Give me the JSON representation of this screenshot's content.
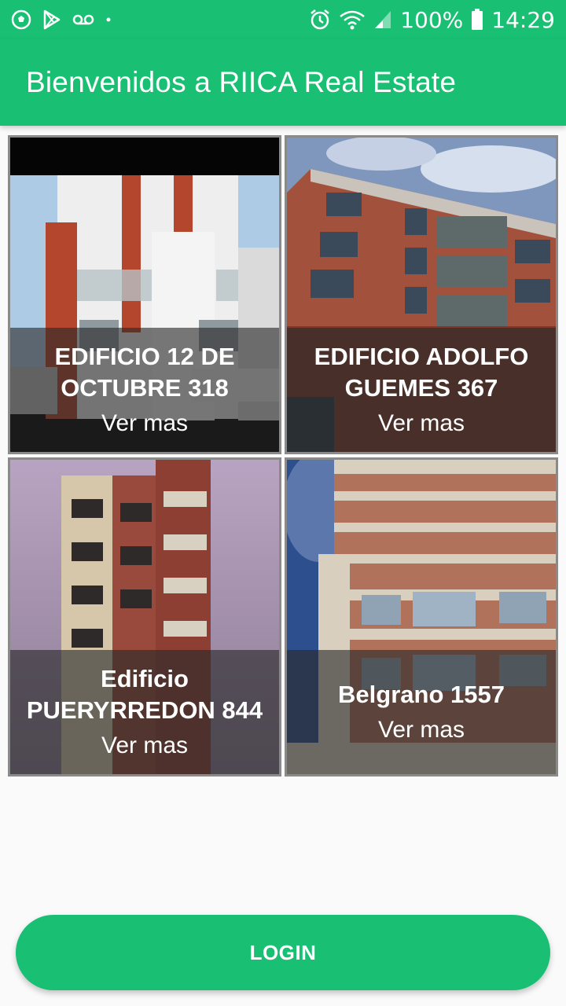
{
  "status_bar": {
    "battery_text": "100%",
    "time": "14:29",
    "icons_left": [
      "soccer-ball-icon",
      "play-store-icon",
      "voicemail-icon",
      "dot-icon"
    ],
    "icons_right": [
      "alarm-icon",
      "wifi-icon",
      "signal-icon",
      "battery-icon"
    ]
  },
  "app_bar": {
    "title": "Bienvenidos a RIICA Real Estate"
  },
  "properties": [
    {
      "title": "EDIFICIO 12 DE OCTUBRE 318",
      "more": "Ver mas"
    },
    {
      "title": "EDIFICIO ADOLFO GUEMES 367",
      "more": "Ver mas"
    },
    {
      "title": "Edificio PUERYRREDON 844",
      "more": "Ver mas"
    },
    {
      "title": "Belgrano 1557",
      "more": "Ver mas"
    }
  ],
  "login": {
    "label": "LOGIN"
  },
  "colors": {
    "accent": "#19bf72",
    "background": "#fafafa"
  }
}
